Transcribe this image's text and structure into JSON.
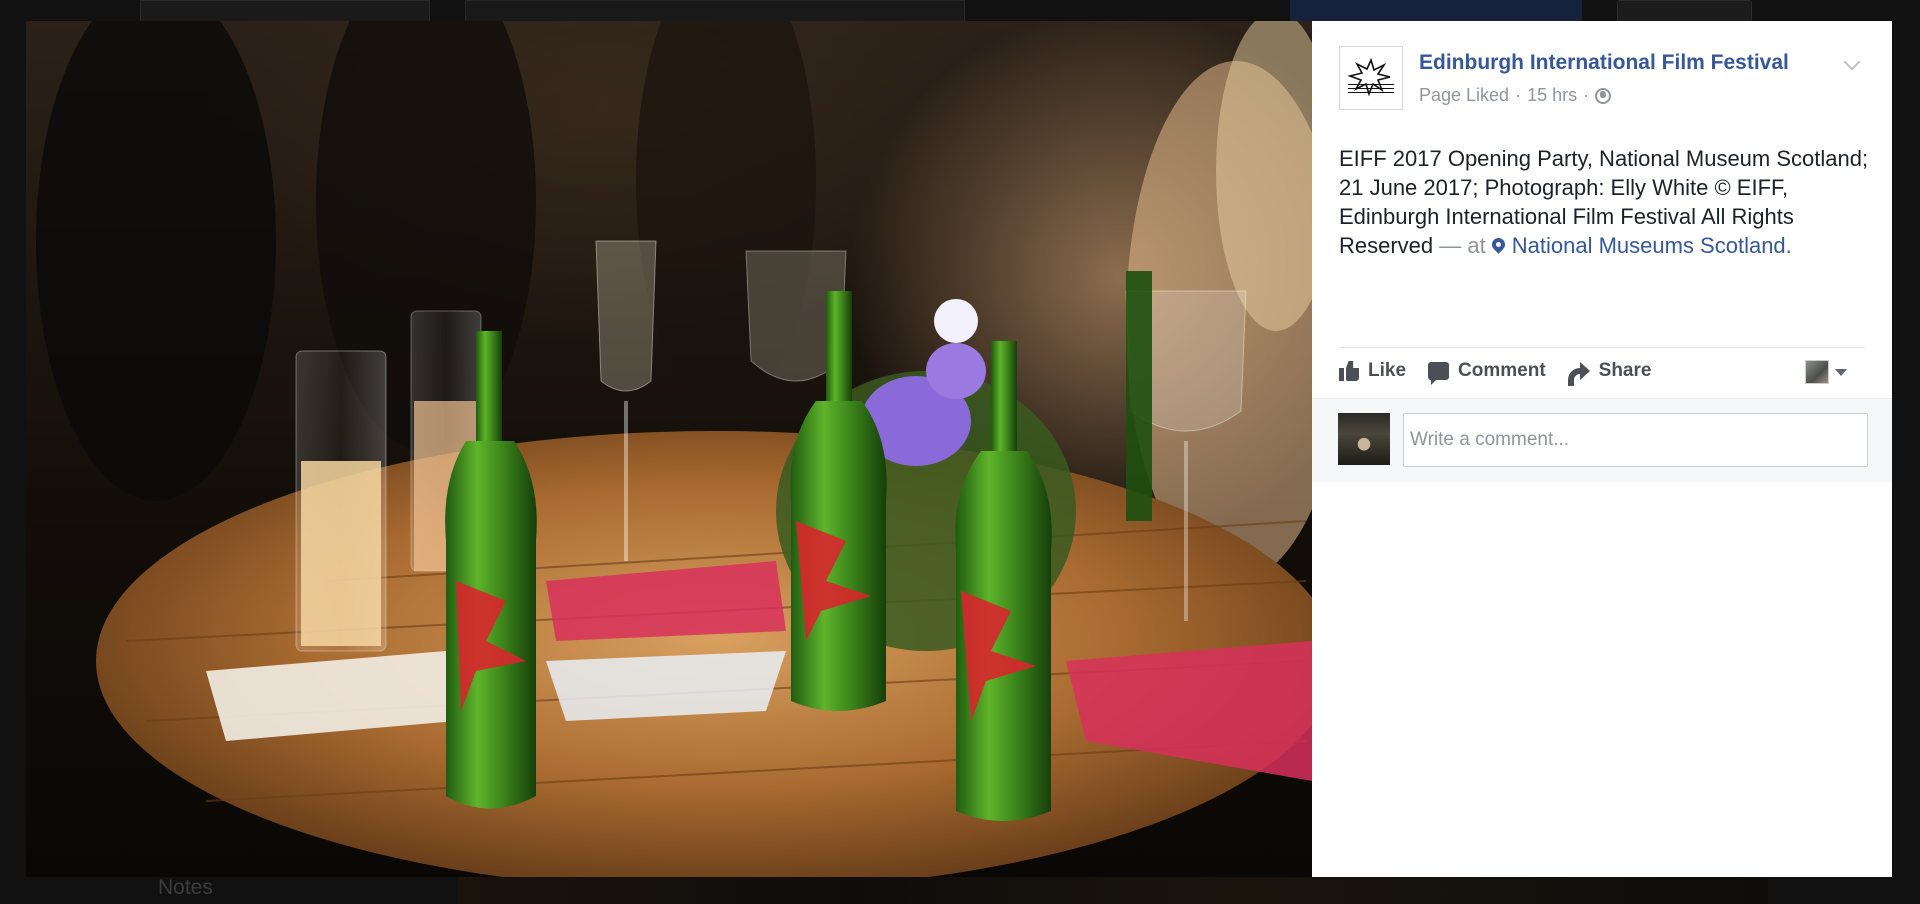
{
  "background_page": {
    "notes_label": "Notes"
  },
  "post": {
    "page_name": "Edinburgh International Film Festival",
    "meta": {
      "status": "Page Liked",
      "separator": "·",
      "time": "15 hrs"
    },
    "caption": {
      "text": "EIFF 2017 Opening Party, National Museum Scotland; 21 June 2017; Photograph: Elly White © EIFF, Edinburgh International Film Festival All Rights Reserved",
      "at_prefix": "— at",
      "place": "National Museums Scotland."
    },
    "actions": {
      "like_label": "Like",
      "comment_label": "Comment",
      "share_label": "Share"
    },
    "comment_box": {
      "placeholder": "Write a comment..."
    }
  },
  "colors": {
    "link": "#365899",
    "text": "#1d2129",
    "muted": "#90949c",
    "action": "#4b4f56",
    "panel_bg": "#ffffff",
    "comment_area_bg": "#f6f7f9"
  },
  "icons": [
    "page-logo-icon",
    "globe-icon",
    "chevron-down-icon",
    "location-pin-icon",
    "like-icon",
    "comment-icon",
    "share-icon",
    "caret-down-icon"
  ]
}
